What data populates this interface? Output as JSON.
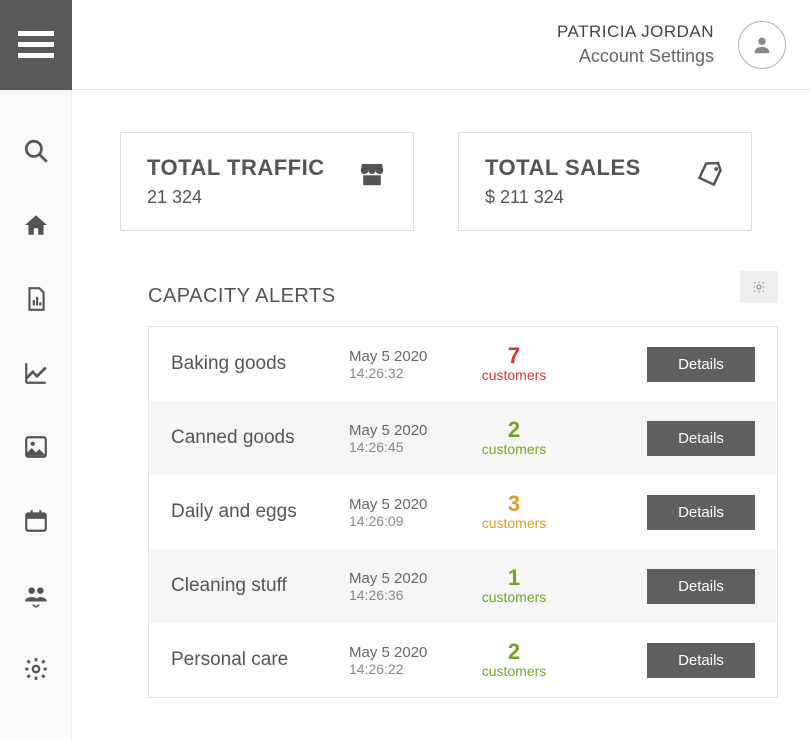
{
  "header": {
    "user_name": "PATRICIA JORDAN",
    "user_sub": "Account Settings"
  },
  "cards": {
    "traffic": {
      "title": "TOTAL TRAFFIC",
      "value": "21 324"
    },
    "sales": {
      "title": "TOTAL SALES",
      "value": "$ 211 324"
    }
  },
  "alerts": {
    "title": "CAPACITY ALERTS",
    "customers_label": "customers",
    "details_label": "Details",
    "rows": [
      {
        "name": "Baking goods",
        "date": "May 5 2020",
        "time": "14:26:32",
        "count": "7",
        "color": "red"
      },
      {
        "name": "Canned goods",
        "date": "May 5 2020",
        "time": "14:26:45",
        "count": "2",
        "color": "green"
      },
      {
        "name": "Daily and eggs",
        "date": "May 5 2020",
        "time": "14:26:09",
        "count": "3",
        "color": "orange"
      },
      {
        "name": "Cleaning stuff",
        "date": "May 5 2020",
        "time": "14:26:36",
        "count": "1",
        "color": "green"
      },
      {
        "name": "Personal care",
        "date": "May 5 2020",
        "time": "14:26:22",
        "count": "2",
        "color": "green"
      }
    ]
  }
}
